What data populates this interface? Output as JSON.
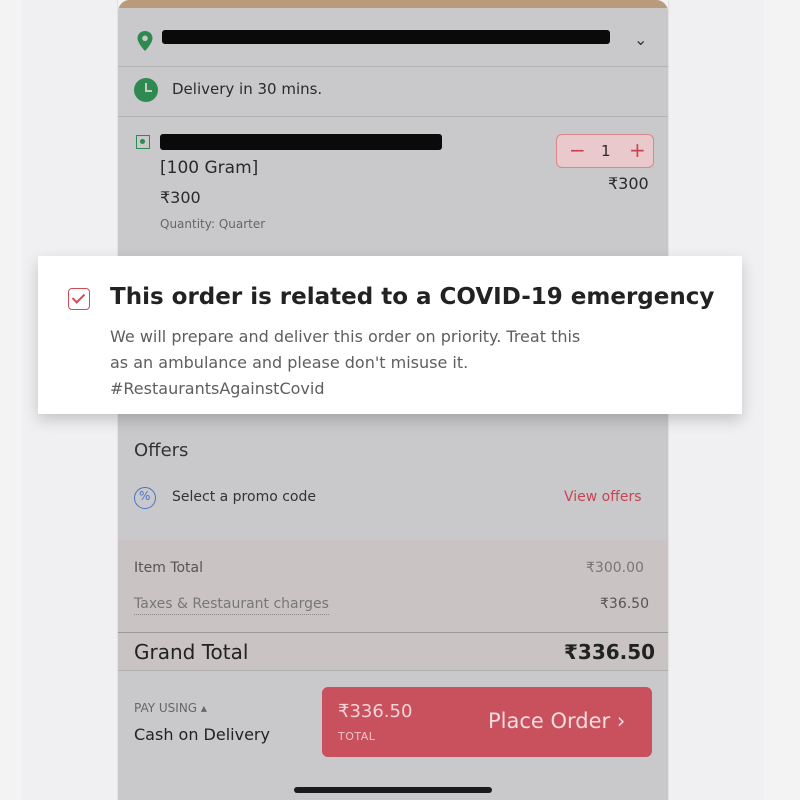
{
  "header": {
    "address_icon": "location-pin-icon",
    "dropdown_icon": "chevron-down-icon",
    "chevron": "⌄"
  },
  "delivery": {
    "icon": "clock-icon",
    "text": "Delivery in 30 mins."
  },
  "item": {
    "veg_icon": "veg-indicator-icon",
    "weight": "[100 Gram]",
    "price": "₹300",
    "quantity": "Quantity: Quarter",
    "stepper": {
      "minus": "−",
      "value": "1",
      "plus": "+"
    },
    "line_total": "₹300"
  },
  "emergency": {
    "checked": true,
    "title": "This order is related to a COVID-19 emergency",
    "body_line1": "We will prepare and deliver this order on priority. Treat this",
    "body_line2": "as an ambulance and please don't misuse it.",
    "body_line3": "#RestaurantsAgainstCovid"
  },
  "offers": {
    "title": "Offers",
    "promo_icon": "percent-badge-icon",
    "promo_text": "Select a promo code",
    "view_offers": "View offers"
  },
  "bill": {
    "item_total_label": "Item Total",
    "item_total_value": "₹300.00",
    "taxes_label": "Taxes & Restaurant charges",
    "taxes_value": "₹36.50",
    "grand_total_label": "Grand Total",
    "grand_total_value": "₹336.50"
  },
  "footer": {
    "pay_using_label": "PAY USING ▴",
    "pay_method": "Cash on Delivery",
    "button_amount": "₹336.50",
    "button_total": "TOTAL",
    "button_label": "Place Order ›"
  },
  "colors": {
    "accent": "#c9515e",
    "veg_green": "#2e8a50",
    "promo_blue": "#4a72c4"
  }
}
